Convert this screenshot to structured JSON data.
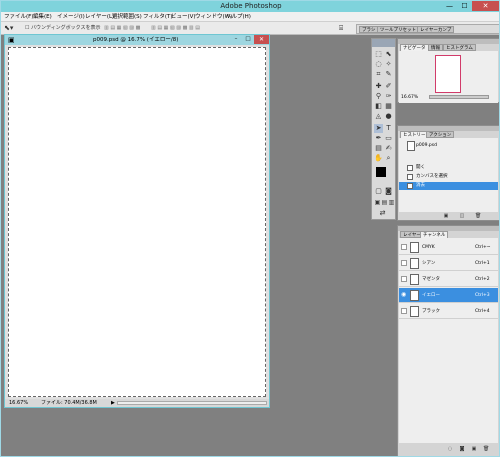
{
  "window": {
    "title": "Adobe Photoshop",
    "min": "—",
    "max": "☐",
    "close": "✕"
  },
  "menu": [
    "ファイル(F)",
    "編集(E)",
    "イメージ(I)",
    "レイヤー(L)",
    "選択範囲(S)",
    "フィルタ(T)",
    "ビュー(V)",
    "ウィンドウ(W)",
    "ヘルプ(H)"
  ],
  "options": {
    "bounding_label": "バウンディングボックスを表示"
  },
  "palette_well": {
    "tabs": [
      "ブラシ",
      "ツールプリセット",
      "レイヤーカンプ"
    ]
  },
  "document": {
    "title": "p009.psd @ 16.7% (イエロー/8)",
    "zoom": "16.67%",
    "file_size": "ファイル: 70.4M/36.8M"
  },
  "navigator": {
    "tabs": [
      "ナビゲータ",
      "情報",
      "ヒストグラム"
    ],
    "zoom": "16.67%"
  },
  "history": {
    "tabs": [
      "ヒストリー",
      "アクション"
    ],
    "snapshot": "p009.psd",
    "items": [
      {
        "label": "開く",
        "selected": false
      },
      {
        "label": "カンバスを選択",
        "selected": false
      },
      {
        "label": "消去",
        "selected": true
      }
    ]
  },
  "channels": {
    "tabs": [
      "レイヤー",
      "チャンネル"
    ],
    "rows": [
      {
        "name": "CMYK",
        "key": "Ctrl+~",
        "selected": false
      },
      {
        "name": "シアン",
        "key": "Ctrl+1",
        "selected": false
      },
      {
        "name": "マゼンタ",
        "key": "Ctrl+2",
        "selected": false
      },
      {
        "name": "イエロー",
        "key": "Ctrl+3",
        "selected": true
      },
      {
        "name": "ブラック",
        "key": "Ctrl+4",
        "selected": false
      }
    ]
  },
  "colors": {
    "titlebar": "#7fd3dc",
    "selection": "#3b8fe0",
    "close": "#c75050"
  }
}
